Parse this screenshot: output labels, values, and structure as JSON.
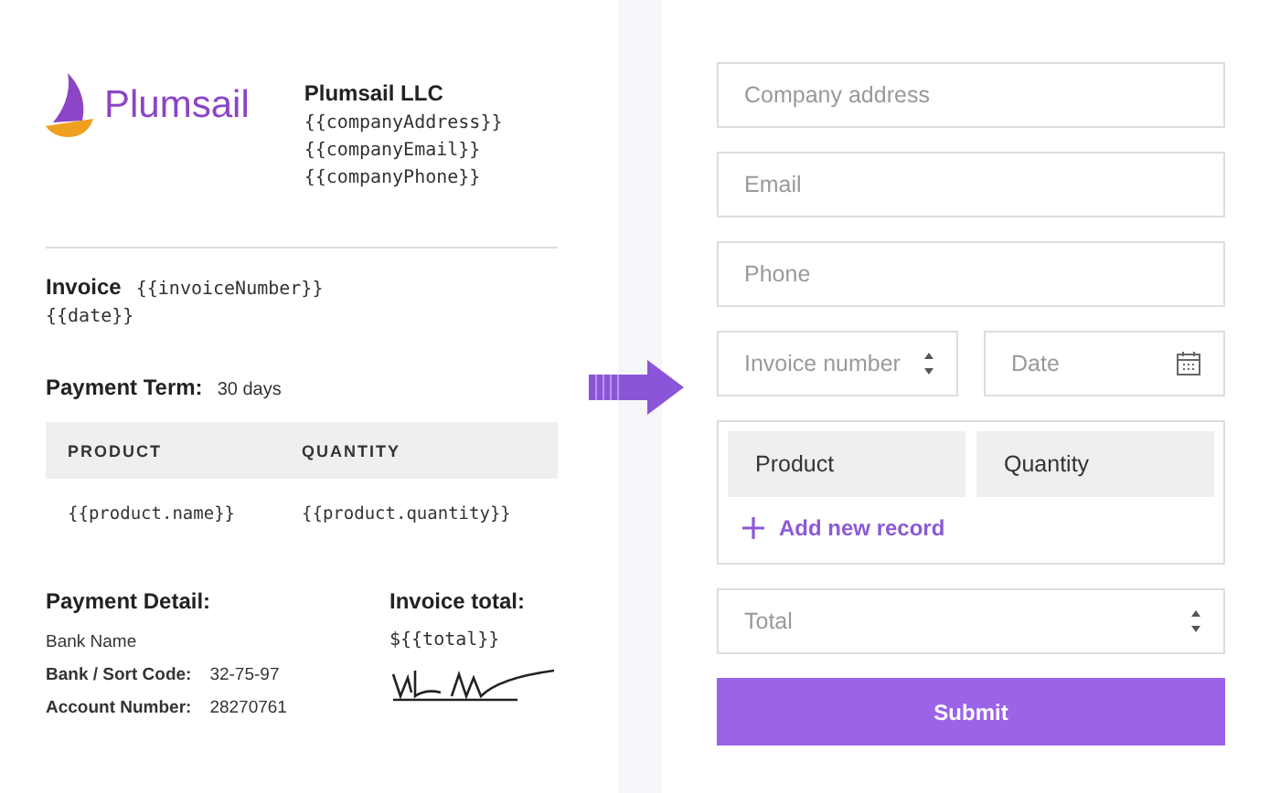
{
  "invoice": {
    "logo_text": "Plumsail",
    "company_name": "Plumsail LLC",
    "company_lines": [
      "{{companyAddress}}",
      "{{companyEmail}}",
      "{{companyPhone}}"
    ],
    "invoice_label": "Invoice",
    "invoice_number": "{{invoiceNumber}}",
    "date": "{{date}}",
    "payment_term_label": "Payment Term:",
    "payment_term": "30 days",
    "table": {
      "columns": [
        "PRODUCT",
        "QUANTITY"
      ],
      "rows": [
        [
          "{{product.name}}",
          "{{product.quantity}}"
        ]
      ]
    },
    "payment_detail_label": "Payment Detail:",
    "bank_name": "Bank Name",
    "bank_rows": [
      {
        "label": "Bank / Sort Code:",
        "value": "32-75-97"
      },
      {
        "label": "Account Number:",
        "value": "28270761"
      }
    ],
    "total_label": "Invoice total:",
    "total": "${{total}}"
  },
  "form": {
    "fields": [
      {
        "placeholder": "Company address"
      },
      {
        "placeholder": "Email"
      },
      {
        "placeholder": "Phone"
      }
    ],
    "pair": [
      {
        "placeholder": "Invoice number",
        "kind": "number"
      },
      {
        "placeholder": "Date",
        "kind": "date"
      }
    ],
    "grid": {
      "columns": [
        "Product",
        "Quantity"
      ],
      "add_label": "Add new record"
    },
    "total": {
      "placeholder": "Total",
      "kind": "number"
    },
    "submit": "Submit"
  }
}
